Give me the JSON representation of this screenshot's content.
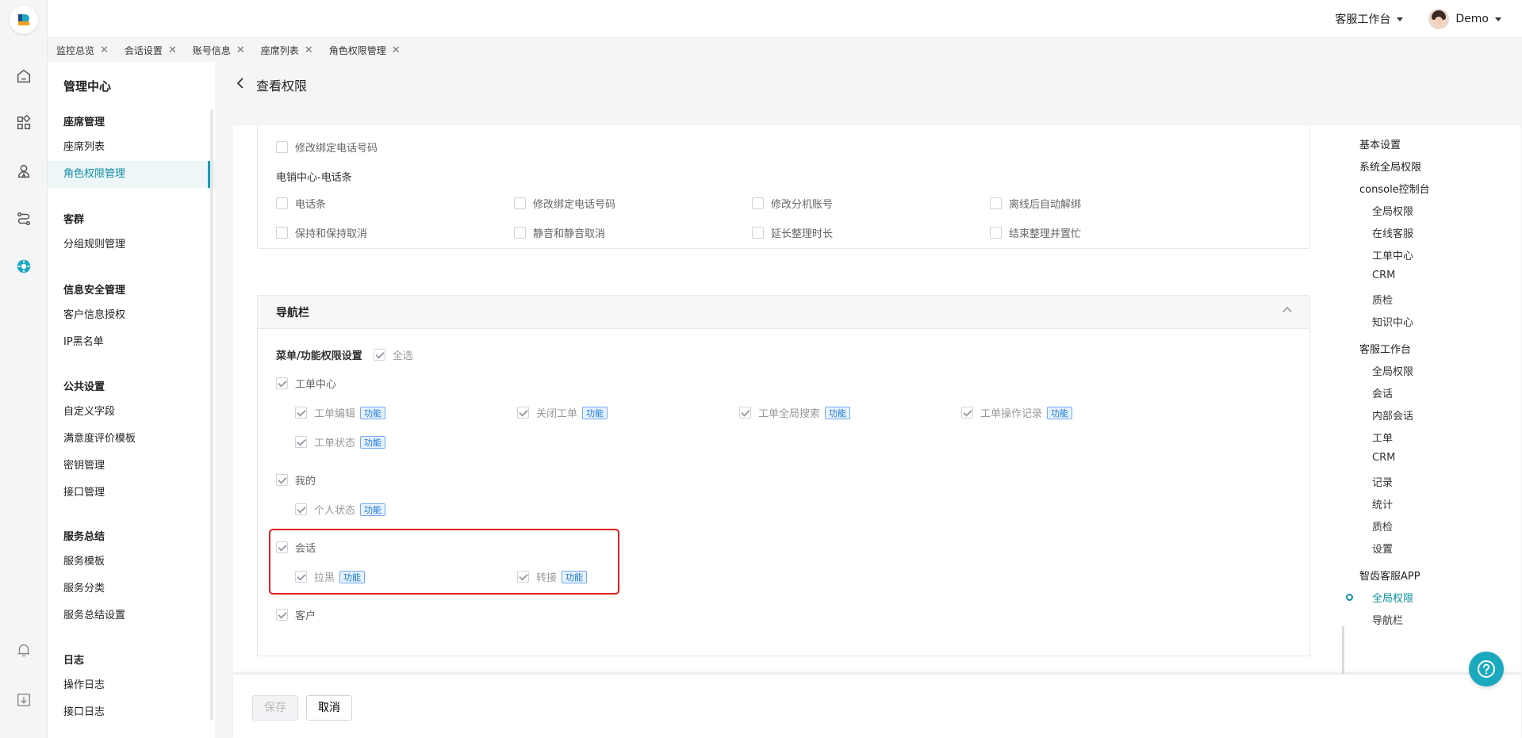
{
  "topbar": {
    "workspace_label": "客服工作台",
    "user_name": "Demo"
  },
  "tabs": [
    "监控总览",
    "会话设置",
    "账号信息",
    "座席列表",
    "角色权限管理"
  ],
  "menu": {
    "title": "管理中心",
    "groups": [
      {
        "title": "座席管理",
        "items": [
          "座席列表",
          "角色权限管理"
        ]
      },
      {
        "title": "客群",
        "items": [
          "分组规则管理"
        ]
      },
      {
        "title": "信息安全管理",
        "items": [
          "客户信息授权",
          "IP黑名单"
        ]
      },
      {
        "title": "公共设置",
        "items": [
          "自定义字段",
          "满意度评价模板",
          "密钥管理",
          "接口管理"
        ]
      },
      {
        "title": "服务总结",
        "items": [
          "服务模板",
          "服务分类",
          "服务总结设置"
        ]
      },
      {
        "title": "日志",
        "items": [
          "操作日志",
          "接口日志"
        ]
      }
    ]
  },
  "page": {
    "title": "查看权限"
  },
  "phone_section": {
    "modify_bind_phone_top": "修改绑定电话号码",
    "subtitle": "电销中心-电话条",
    "row1": [
      "电话条",
      "修改绑定电话号码",
      "修改分机账号",
      "离线后自动解绑"
    ],
    "row2": [
      "保持和保持取消",
      "静音和静音取消",
      "延长整理时长",
      "结束整理并置忙"
    ]
  },
  "nav_section": {
    "title": "导航栏",
    "menu_setting_label": "菜单/功能权限设置",
    "select_all": "全选",
    "badge": "功能",
    "ticket_center": "工单中心",
    "ticket_items": [
      "工单编辑",
      "关闭工单",
      "工单全局搜索",
      "工单操作记录",
      "工单状态"
    ],
    "mine": "我的",
    "mine_items": [
      "个人状态"
    ],
    "session": "会话",
    "session_items": [
      "拉黑",
      "转接"
    ],
    "customer": "客户"
  },
  "anchor_nav": {
    "items": [
      {
        "label": "基本设置",
        "level": 1
      },
      {
        "label": "系统全局权限",
        "level": 1
      },
      {
        "label": "console控制台",
        "level": 1
      },
      {
        "label": "全局权限",
        "level": 2
      },
      {
        "label": "在线客服",
        "level": 2
      },
      {
        "label": "工单中心",
        "level": 2
      },
      {
        "label": "CRM",
        "level": 2
      },
      {
        "label": "质检",
        "level": 2
      },
      {
        "label": "知识中心",
        "level": 2
      },
      {
        "label": "客服工作台",
        "level": 1
      },
      {
        "label": "全局权限",
        "level": 2
      },
      {
        "label": "会话",
        "level": 2
      },
      {
        "label": "内部会话",
        "level": 2
      },
      {
        "label": "工单",
        "level": 2
      },
      {
        "label": "CRM",
        "level": 2
      },
      {
        "label": "记录",
        "level": 2
      },
      {
        "label": "统计",
        "level": 2
      },
      {
        "label": "质检",
        "level": 2
      },
      {
        "label": "设置",
        "level": 2
      },
      {
        "label": "智齿客服APP",
        "level": 1
      },
      {
        "label": "全局权限",
        "level": 2,
        "active": true
      },
      {
        "label": "导航栏",
        "level": 2
      }
    ]
  },
  "footer": {
    "save_label": "保存",
    "cancel_label": "取消"
  },
  "colors": {
    "accent": "#0e8fa3",
    "highlight_border": "#e21d1d",
    "badge_text": "#1476d6"
  }
}
